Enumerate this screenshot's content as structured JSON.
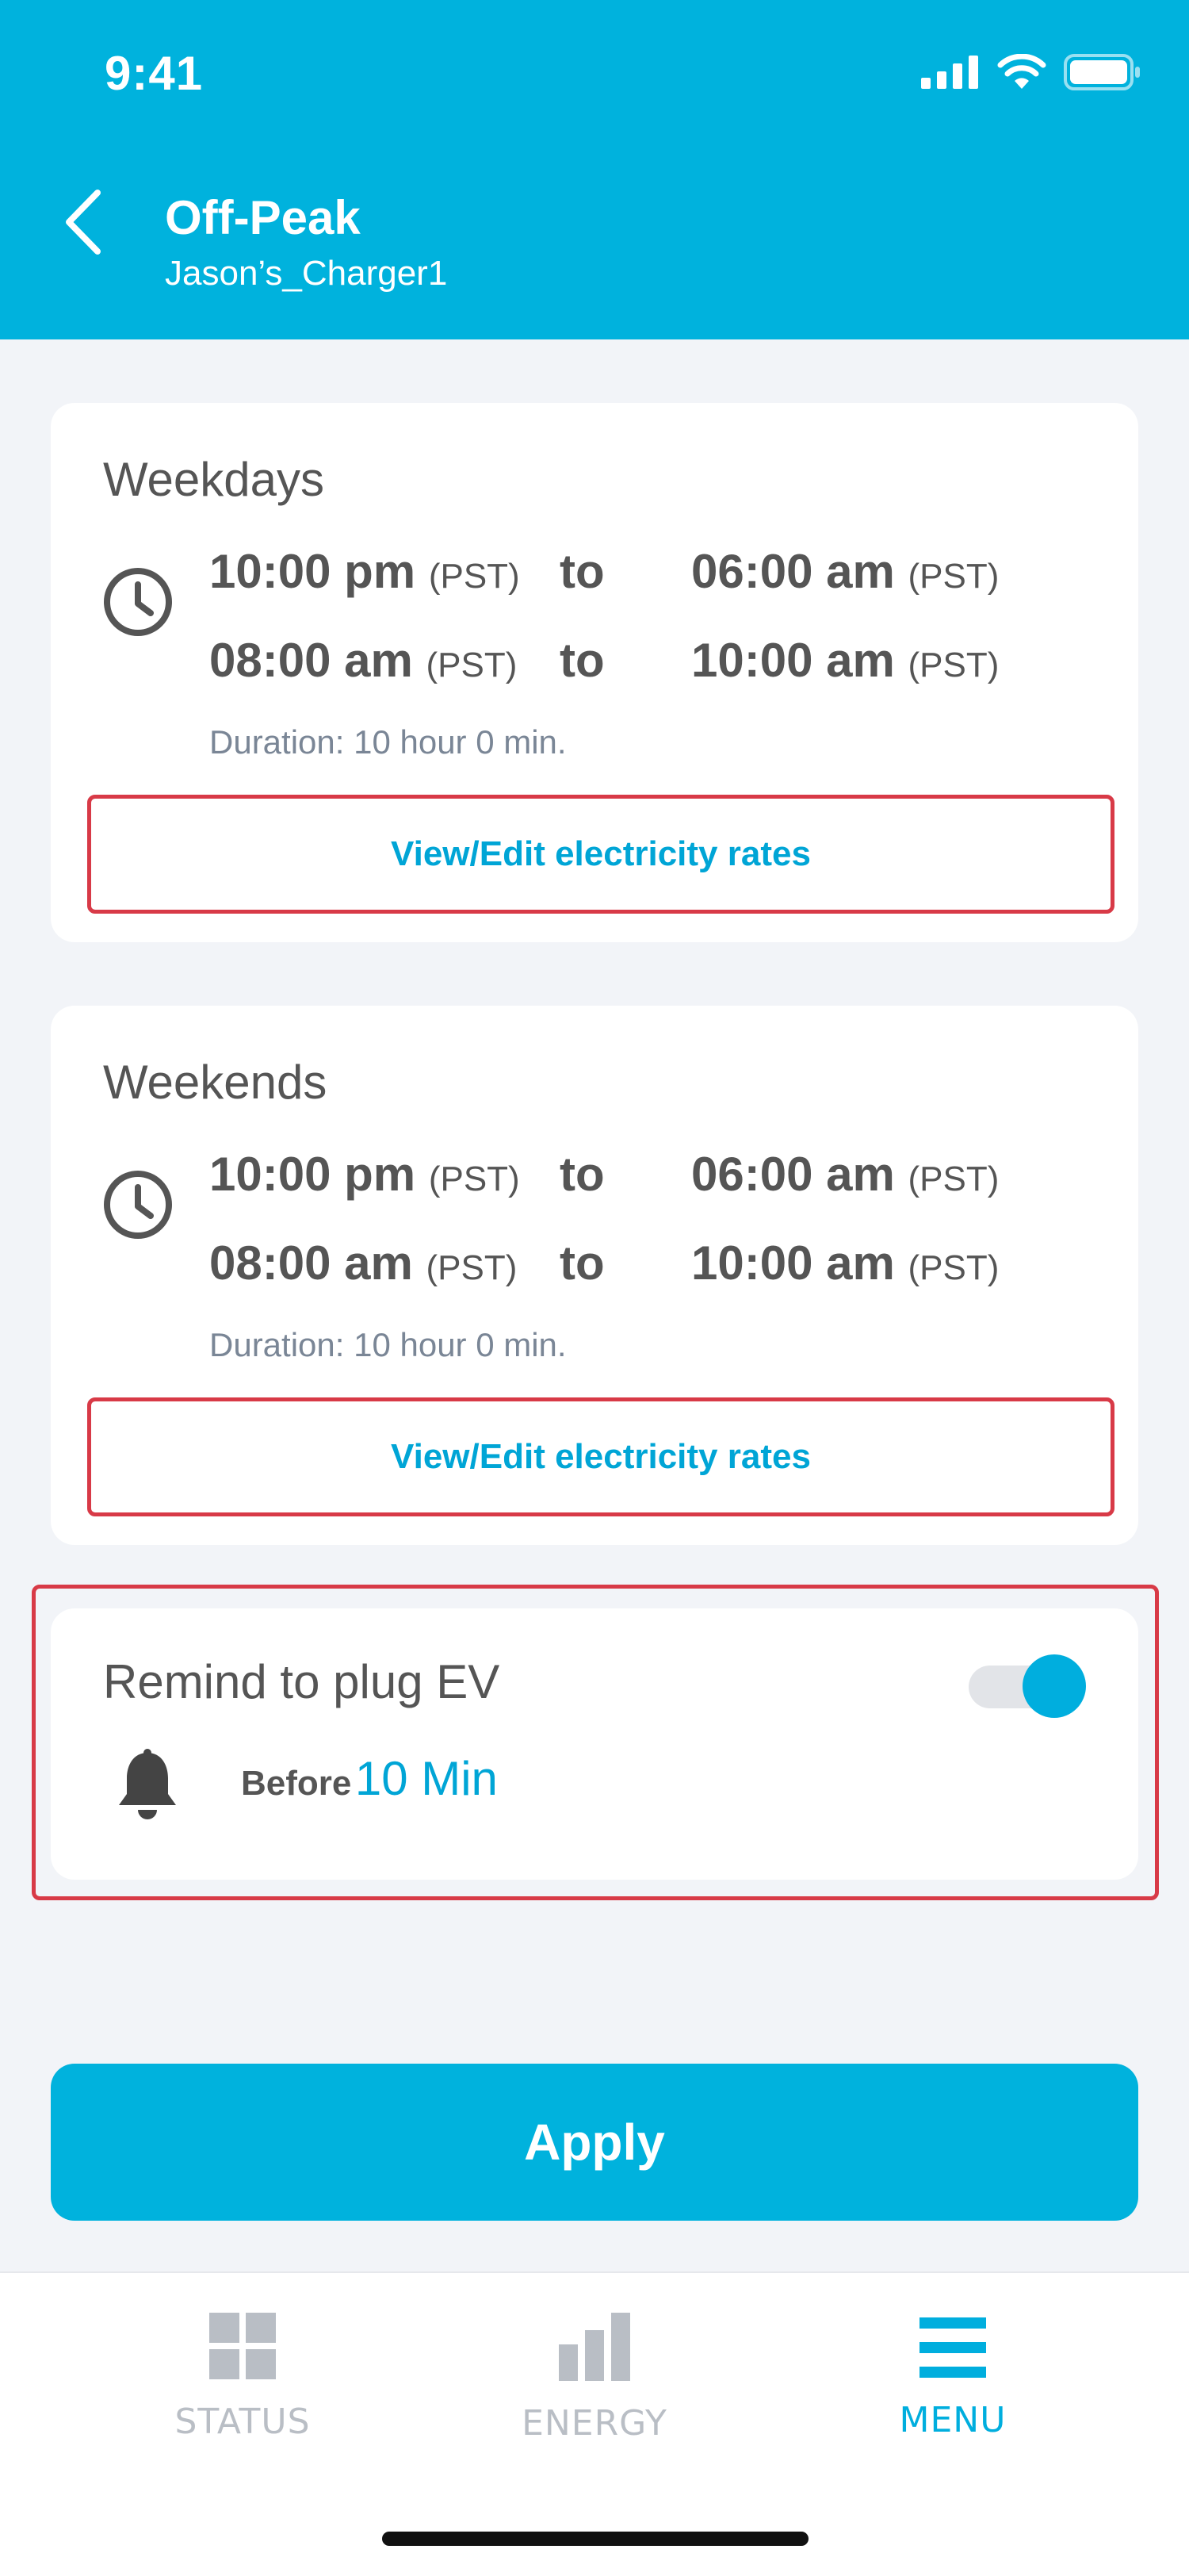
{
  "status_bar": {
    "time": "9:41"
  },
  "header": {
    "title": "Off-Peak",
    "subtitle": "Jason’s_Charger1",
    "back_icon": "chevron-left-icon"
  },
  "weekdays": {
    "title": "Weekdays",
    "rows": [
      {
        "start": "10:00 pm",
        "start_tz": "(PST)",
        "to": "to",
        "end": "06:00 am",
        "end_tz": "(PST)"
      },
      {
        "start": "08:00 am",
        "start_tz": "(PST)",
        "to": "to",
        "end": "10:00 am",
        "end_tz": "(PST)"
      }
    ],
    "duration": "Duration: 10 hour 0 min.",
    "rates_label": "View/Edit electricity rates"
  },
  "weekends": {
    "title": "Weekends",
    "rows": [
      {
        "start": "10:00 pm",
        "start_tz": "(PST)",
        "to": "to",
        "end": "06:00 am",
        "end_tz": "(PST)"
      },
      {
        "start": "08:00 am",
        "start_tz": "(PST)",
        "to": "to",
        "end": "10:00 am",
        "end_tz": "(PST)"
      }
    ],
    "duration": "Duration: 10 hour 0 min.",
    "rates_label": "View/Edit electricity rates"
  },
  "reminder": {
    "title": "Remind to plug EV",
    "enabled": true,
    "before_label": "Before",
    "before_value": "10 Min"
  },
  "apply_label": "Apply",
  "tabs": [
    {
      "label": "STATUS",
      "icon": "grid-icon",
      "active": false
    },
    {
      "label": "ENERGY",
      "icon": "bar-chart-icon",
      "active": false
    },
    {
      "label": "MENU",
      "icon": "menu-icon",
      "active": true
    }
  ],
  "colors": {
    "accent": "#00b2dd",
    "highlight": "#d83a47",
    "inactive_tab": "#b9bec5"
  }
}
